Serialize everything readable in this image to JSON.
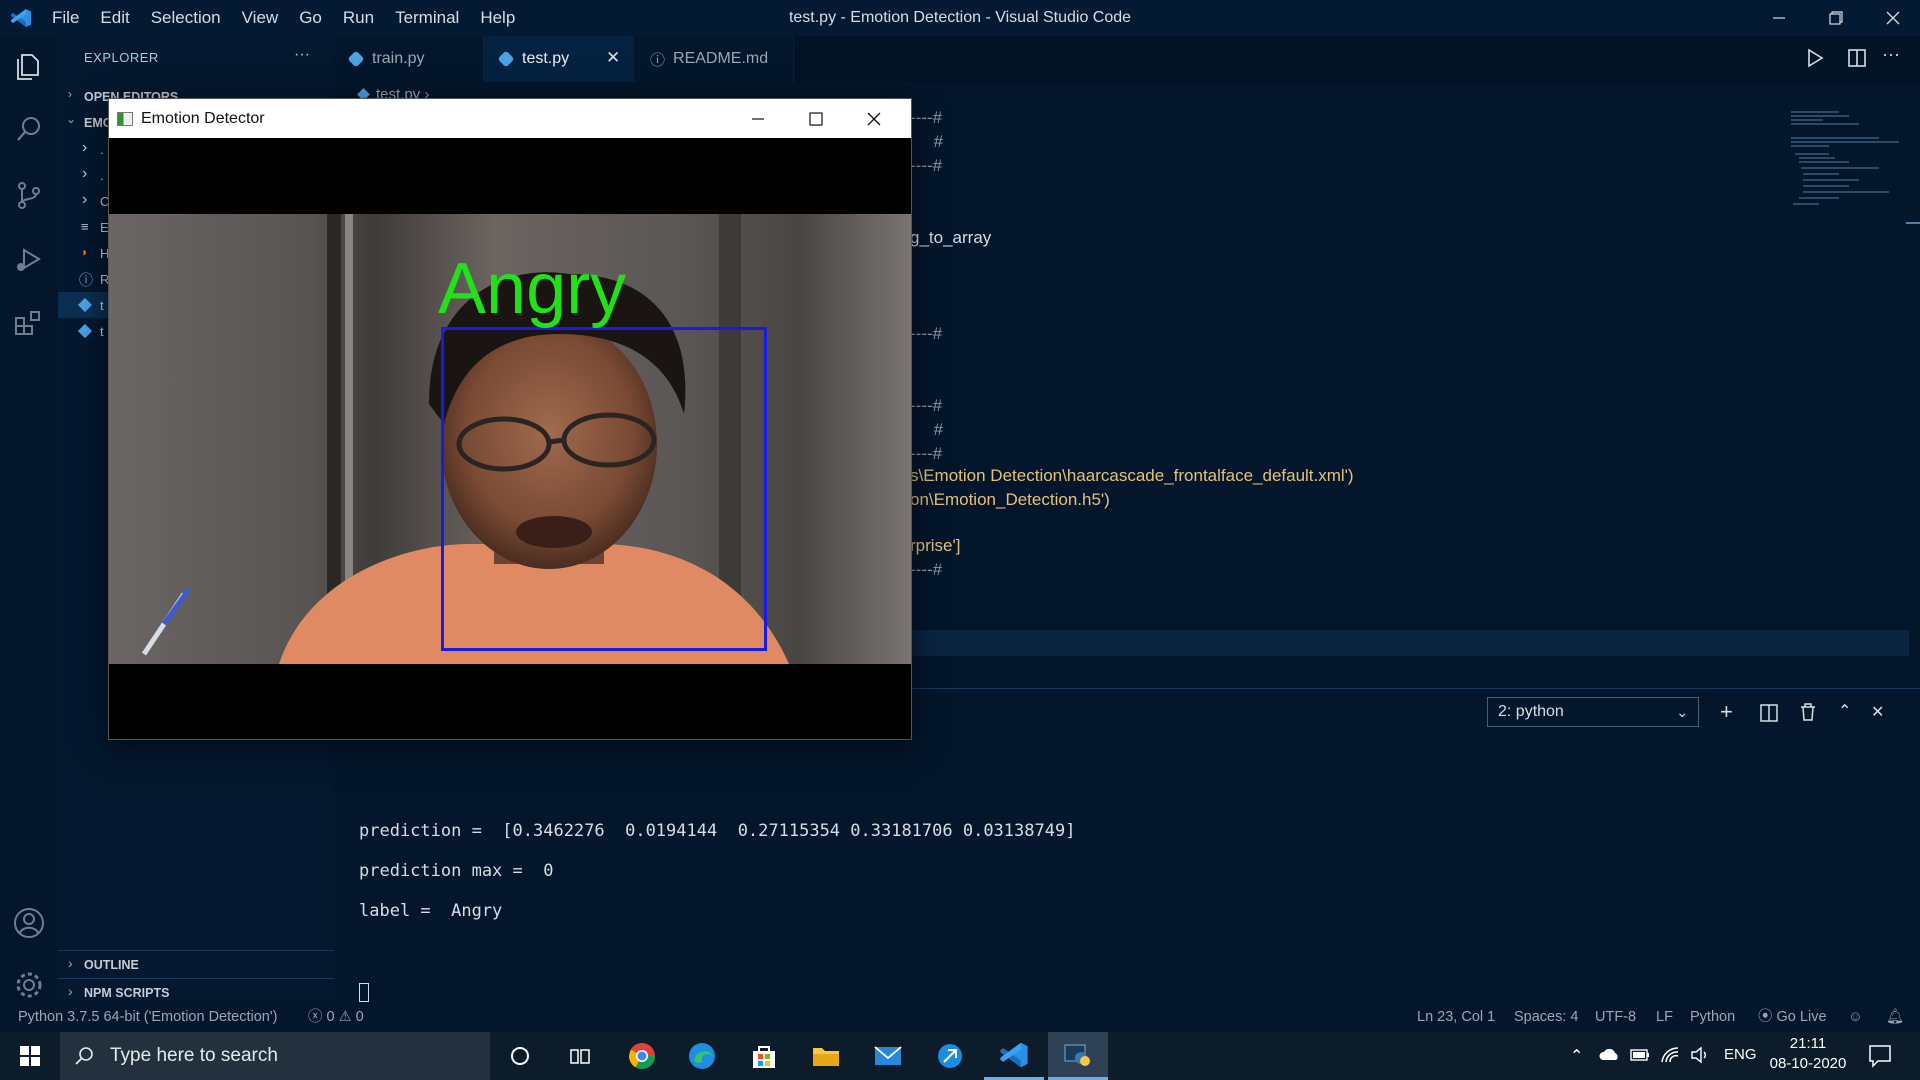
{
  "window": {
    "title": "test.py - Emotion Detection - Visual Studio Code",
    "menu": [
      "File",
      "Edit",
      "Selection",
      "View",
      "Go",
      "Run",
      "Terminal",
      "Help"
    ]
  },
  "sidebar": {
    "header": "EXPLORER",
    "open_editors": "OPEN EDITORS",
    "folder": "EMO",
    "items": [
      {
        "label": "."
      },
      {
        "label": "."
      },
      {
        "label": "C"
      },
      {
        "label": "E"
      },
      {
        "label": "H"
      },
      {
        "label": "R"
      },
      {
        "label": "t"
      },
      {
        "label": "t"
      }
    ],
    "outline": "OUTLINE",
    "npm_scripts": "NPM SCRIPTS"
  },
  "tabs": [
    {
      "label": "train.py",
      "active": false
    },
    {
      "label": "test.py",
      "active": true
    },
    {
      "label": "README.md",
      "active": false
    }
  ],
  "breadcrumb": "test.py",
  "editor_lines": [
    {
      "text": "----#",
      "kind": "cm"
    },
    {
      "text": "     #",
      "kind": "cm"
    },
    {
      "text": "----#",
      "kind": "cm"
    },
    {
      "text": "g_to_array",
      "kind": "code"
    },
    {
      "text": "----#",
      "kind": "cm"
    },
    {
      "text": "----#",
      "kind": "cm"
    },
    {
      "text": "     #",
      "kind": "cm"
    },
    {
      "text": "----#",
      "kind": "cm"
    },
    {
      "text": "s\\Emotion Detection\\haarcascade_frontalface_default.xml')",
      "kind": "str"
    },
    {
      "text": "on\\Emotion_Detection.h5')",
      "kind": "str"
    },
    {
      "text": "rprise']",
      "kind": "str"
    },
    {
      "text": "----#",
      "kind": "cm"
    }
  ],
  "detector": {
    "title": "Emotion Detector",
    "label": "Angry",
    "label_color": "#22e01a",
    "box_color": "#1a1ae6"
  },
  "terminal": {
    "dropdown": "2: python",
    "lines": [
      "prediction =  [0.3462276  0.0194144  0.27115354 0.33181706 0.03138749]",
      "prediction max =  0",
      "label =  Angry"
    ]
  },
  "status": {
    "interpreter": "Python 3.7.5 64-bit ('Emotion Detection')",
    "errors": "0",
    "warnings": "0",
    "position": "Ln 23, Col 1",
    "spaces": "Spaces: 4",
    "encoding": "UTF-8",
    "eol": "LF",
    "language": "Python",
    "golive": "Go Live"
  },
  "taskbar": {
    "search_placeholder": "Type here to search",
    "lang": "ENG",
    "time": "21:11",
    "date": "08-10-2020"
  }
}
